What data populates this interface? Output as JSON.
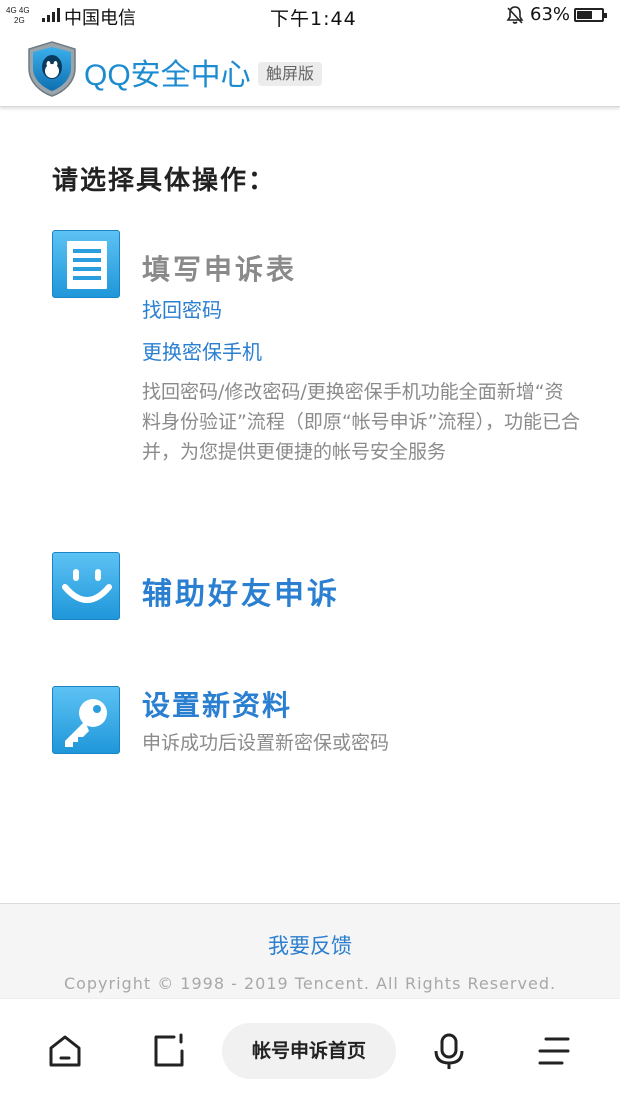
{
  "status_bar": {
    "network_top": "4G 4G",
    "network_bottom": "2G",
    "carrier": "中国电信",
    "time": "下午1:44",
    "battery_percent": "63%",
    "battery_level": 0.63
  },
  "header": {
    "title": "QQ安全中心",
    "badge": "触屏版"
  },
  "main": {
    "prompt": "请选择具体操作：",
    "options": [
      {
        "title": "填写申诉表",
        "links": [
          "找回密码",
          "更换密保手机"
        ],
        "description": "找回密码/修改密码/更换密保手机功能全面新增“资料身份验证”流程（即原“帐号申诉”流程），功能已合并，为您提供更便捷的帐号安全服务"
      },
      {
        "title": "辅助好友申诉"
      },
      {
        "title": "设置新资料",
        "description": "申诉成功后设置新密保或密码"
      }
    ]
  },
  "footer": {
    "feedback": "我要反馈",
    "copyright": "Copyright © 1998 - 2019 Tencent. All Rights Reserved."
  },
  "browser_bar": {
    "center_label": "帐号申诉首页",
    "icons": [
      "home-icon",
      "tabs-icon",
      "microphone-icon",
      "menu-icon"
    ]
  },
  "colors": {
    "brand_blue": "#1d8bd0",
    "link_blue": "#2a7fd0",
    "icon_blue": "#1f97d9"
  }
}
